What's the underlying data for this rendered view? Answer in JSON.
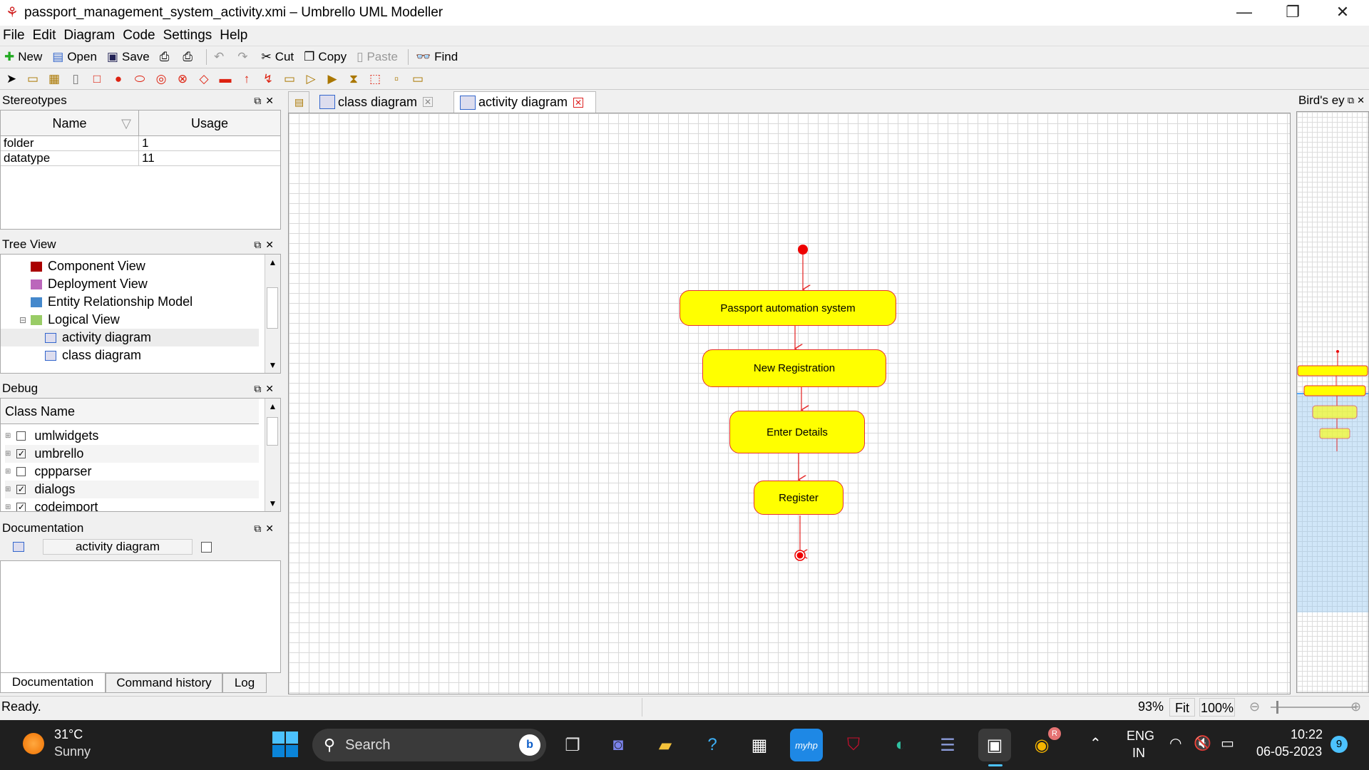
{
  "window": {
    "title": "passport_management_system_activity.xmi – Umbrello UML Modeller"
  },
  "menu": [
    "File",
    "Edit",
    "Diagram",
    "Code",
    "Settings",
    "Help"
  ],
  "toolbar": {
    "new": "New",
    "open": "Open",
    "save": "Save",
    "cut": "Cut",
    "copy": "Copy",
    "paste": "Paste",
    "find": "Find"
  },
  "stereotypes": {
    "title": "Stereotypes",
    "columns": [
      "Name",
      "Usage"
    ],
    "rows": [
      {
        "name": "folder",
        "usage": "1"
      },
      {
        "name": "datatype",
        "usage": "11"
      }
    ]
  },
  "tree_view": {
    "title": "Tree View",
    "items": [
      "Component View",
      "Deployment View",
      "Entity Relationship Model",
      "Logical View",
      "activity diagram",
      "class diagram"
    ]
  },
  "debug": {
    "title": "Debug",
    "column": "Class Name",
    "items": [
      {
        "label": "umlwidgets",
        "checked": false
      },
      {
        "label": "umbrello",
        "checked": true
      },
      {
        "label": "cppparser",
        "checked": false
      },
      {
        "label": "dialogs",
        "checked": true
      },
      {
        "label": "codeimport",
        "checked": true
      }
    ]
  },
  "documentation": {
    "title": "Documentation",
    "name": "activity diagram",
    "bottom_tabs": [
      "Documentation",
      "Command history",
      "Log"
    ]
  },
  "tabs": [
    "class diagram",
    "activity diagram"
  ],
  "birds_eye": {
    "title": "Bird's ey"
  },
  "diagram": {
    "nodes": [
      "Passport automation system",
      "New Registration",
      "Enter Details",
      "Register"
    ],
    "colors": {
      "fill": "#ffff00",
      "border": "#e53030"
    }
  },
  "status": {
    "text": "Ready.",
    "zoom": "93%",
    "fit": "Fit",
    "hundred": "100%"
  },
  "taskbar": {
    "weather_temp": "31°C",
    "weather_cond": "Sunny",
    "search": "Search",
    "lang1": "ENG",
    "lang2": "IN",
    "time": "10:22",
    "date": "06-05-2023",
    "badge": "9"
  }
}
